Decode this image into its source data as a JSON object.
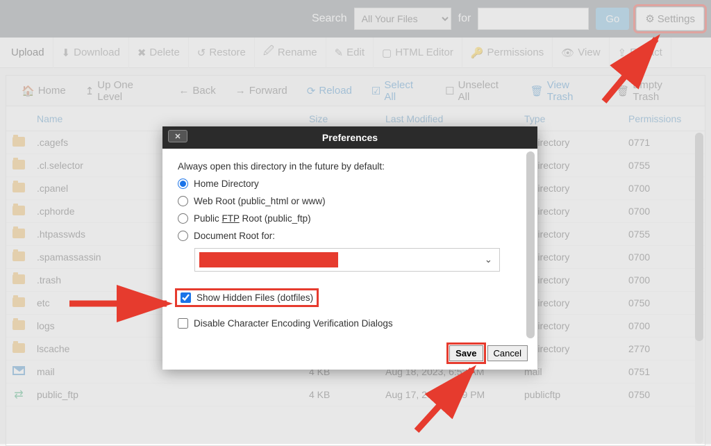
{
  "topbar": {
    "search_label": "Search",
    "scope_selected": "All Your Files",
    "for_label": "for",
    "search_value": "",
    "go_label": "Go",
    "settings_label": "Settings"
  },
  "toolbar": {
    "upload": "Upload",
    "download": "Download",
    "delete": "Delete",
    "restore": "Restore",
    "rename": "Rename",
    "edit": "Edit",
    "html_editor": "HTML Editor",
    "permissions": "Permissions",
    "view": "View",
    "extract": "Extract"
  },
  "nav": {
    "home": "Home",
    "up": "Up One Level",
    "back": "Back",
    "forward": "Forward",
    "reload": "Reload",
    "select_all": "Select All",
    "unselect_all": "Unselect All",
    "view_trash": "View Trash",
    "empty_trash": "Empty Trash"
  },
  "table": {
    "head": {
      "name": "Name",
      "size": "Size",
      "modified": "Last Modified",
      "type": "Type",
      "perm": "Permissions"
    },
    "rows": [
      {
        "icon": "folder",
        "name": ".cagefs",
        "size": "",
        "mod": "",
        "type": "x-directory",
        "perm": "0771"
      },
      {
        "icon": "folder",
        "name": ".cl.selector",
        "size": "",
        "mod": "",
        "type": "x-directory",
        "perm": "0755"
      },
      {
        "icon": "folder",
        "name": ".cpanel",
        "size": "",
        "mod": "",
        "type": "x-directory",
        "perm": "0700"
      },
      {
        "icon": "folder",
        "name": ".cphorde",
        "size": "",
        "mod": "",
        "type": "x-directory",
        "perm": "0700"
      },
      {
        "icon": "folder",
        "name": ".htpasswds",
        "size": "",
        "mod": "",
        "type": "x-directory",
        "perm": "0755"
      },
      {
        "icon": "folder",
        "name": ".spamassassin",
        "size": "",
        "mod": "",
        "type": "x-directory",
        "perm": "0700"
      },
      {
        "icon": "folder",
        "name": ".trash",
        "size": "",
        "mod": "",
        "type": "x-directory",
        "perm": "0700"
      },
      {
        "icon": "folder",
        "name": "etc",
        "size": "",
        "mod": "",
        "type": "x-directory",
        "perm": "0750"
      },
      {
        "icon": "folder",
        "name": "logs",
        "size": "",
        "mod": "",
        "type": "x-directory",
        "perm": "0700"
      },
      {
        "icon": "folder",
        "name": "lscache",
        "size": "",
        "mod": "",
        "type": "x-directory",
        "perm": "2770"
      },
      {
        "icon": "mail",
        "name": "mail",
        "size": "4 KB",
        "mod": "Aug 18, 2023, 6:53 AM",
        "type": "mail",
        "perm": "0751"
      },
      {
        "icon": "link",
        "name": "public_ftp",
        "size": "4 KB",
        "mod": "Aug 17, 2023, 5:39 PM",
        "type": "publicftp",
        "perm": "0750"
      }
    ]
  },
  "modal": {
    "title": "Preferences",
    "intro": "Always open this directory in the future by default:",
    "opt_home": "Home Directory",
    "opt_webroot": "Web Root (public_html or www)",
    "opt_pubftp": "Public FTP Root (public_ftp)",
    "opt_docroot": "Document Root for:",
    "chk_hidden": "Show Hidden Files (dotfiles)",
    "chk_encoding": "Disable Character Encoding Verification Dialogs",
    "save": "Save",
    "cancel": "Cancel"
  },
  "annotations": {
    "highlight_color": "#e63b2e"
  }
}
